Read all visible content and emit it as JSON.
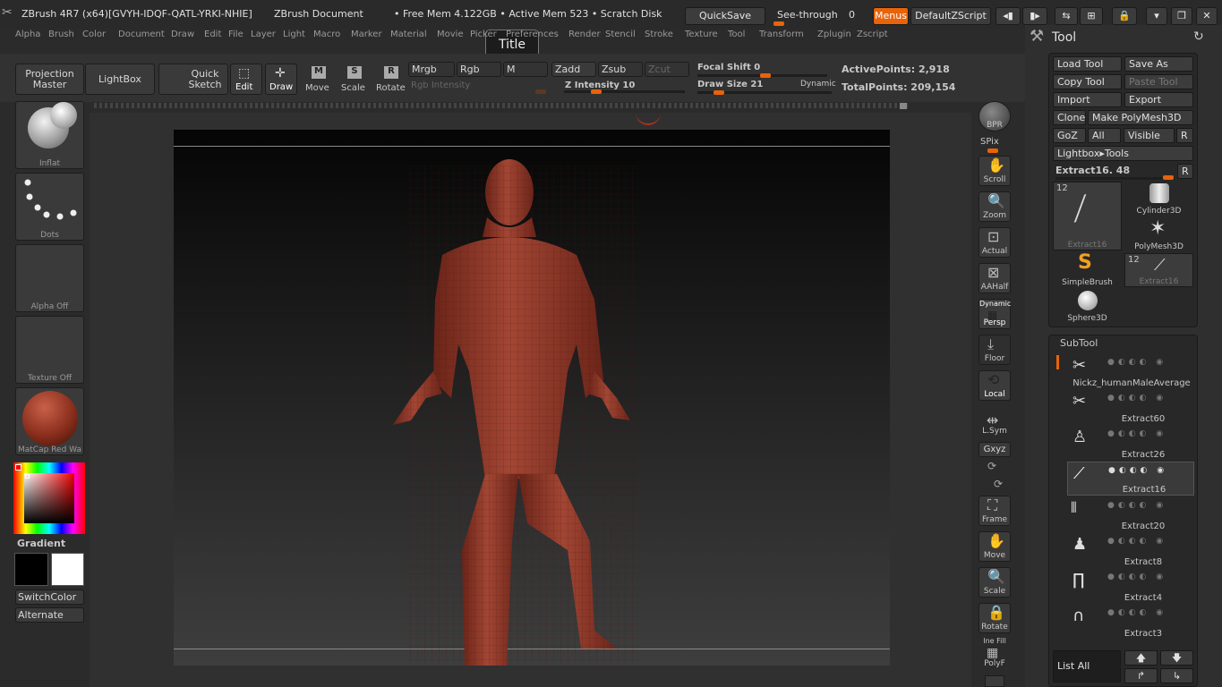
{
  "titlebar": {
    "app_title": "ZBrush 4R7 (x64)[GVYH-IDQF-QATL-YRKI-NHIE]",
    "doc_title": "ZBrush Document",
    "mem": "• Free Mem 4.122GB • Active Mem 523 • Scratch Disk",
    "quicksave": "QuickSave",
    "seethrough": "See-through",
    "seethrough_val": "0",
    "menus": "Menus",
    "script": "DefaultZScript"
  },
  "menus": [
    "Alpha",
    "Brush",
    "Color",
    "Document",
    "Draw",
    "Edit",
    "File",
    "Layer",
    "Light",
    "Macro",
    "Marker",
    "Material",
    "Movie",
    "Picker",
    "Preferences",
    "Render",
    "Stencil",
    "Stroke",
    "Texture",
    "Tool",
    "Transform",
    "Zplugin",
    "Zscript"
  ],
  "tooltip": "Title",
  "shelf": {
    "projection_master": "Projection Master",
    "lightbox": "LightBox",
    "quick_sketch": "Quick Sketch",
    "edit": "Edit",
    "draw": "Draw",
    "move": "Move",
    "scale": "Scale",
    "rotate": "Rotate",
    "mrgb": "Mrgb",
    "rgb": "Rgb",
    "m": "M",
    "zadd": "Zadd",
    "zsub": "Zsub",
    "zcut": "Zcut",
    "rgb_intensity": "Rgb Intensity",
    "z_intensity": "Z Intensity 10",
    "focal_shift": "Focal Shift 0",
    "draw_size": "Draw Size 21",
    "dynamic": "Dynamic",
    "active_points": "ActivePoints: 2,918",
    "total_points": "TotalPoints: 209,154"
  },
  "left": {
    "brush": "Inflat",
    "stroke": "Dots",
    "alpha": "Alpha  Off",
    "texture": "Texture  Off",
    "material": "MatCap  Red  Wa",
    "gradient": "Gradient",
    "switchcolor": "SwitchColor",
    "alternate": "Alternate"
  },
  "rightbar": {
    "bpr": "BPR",
    "spix": "SPix",
    "scroll": "Scroll",
    "zoom": "Zoom",
    "actual": "Actual",
    "aahalf": "AAHalf",
    "persp": "Persp",
    "dynamic": "Dynamic",
    "floor": "Floor",
    "local": "Local",
    "lsym": "L.Sym",
    "xyz": "Gxyz",
    "frame": "Frame",
    "move": "Move",
    "scale": "Scale",
    "rotate": "Rotate",
    "linefill": "Ine Fill",
    "polyf": "PolyF"
  },
  "tool": {
    "title": "Tool",
    "load": "Load Tool",
    "saveas": "Save As",
    "copy": "Copy Tool",
    "paste": "Paste Tool",
    "import": "Import",
    "export": "Export",
    "clone": "Clone",
    "make_polymesh": "Make PolyMesh3D",
    "goz": "GoZ",
    "all": "All",
    "visible": "Visible",
    "r": "R",
    "lightbox_tools": "Lightbox▸Tools",
    "extract_slider": "Extract16. 48",
    "thumbs": [
      {
        "label": "Extract16",
        "badge": "12"
      },
      {
        "label": "Cylinder3D",
        "badge": ""
      },
      {
        "label": "PolyMesh3D",
        "badge": ""
      },
      {
        "label": "SimpleBrush",
        "badge": ""
      },
      {
        "label": "Extract16",
        "badge": "12"
      },
      {
        "label": "Sphere3D",
        "badge": ""
      }
    ]
  },
  "subtool": {
    "title": "SubTool",
    "items": [
      "Nickz_humanMaleAverage",
      "Extract60",
      "Extract26",
      "Extract16",
      "Extract20",
      "Extract8",
      "Extract4",
      "Extract3"
    ],
    "list_all": "List All"
  }
}
